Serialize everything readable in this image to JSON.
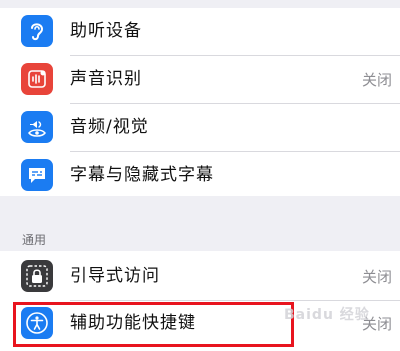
{
  "settings": {
    "rows_top": [
      {
        "label": "助听设备",
        "value": "",
        "icon": "ear-icon",
        "color": "#1b7cf2"
      },
      {
        "label": "声音识别",
        "value": "关闭",
        "icon": "sound-recognition-icon",
        "color": "#e8443a"
      },
      {
        "label": "音频/视觉",
        "value": "",
        "icon": "audio-visual-icon",
        "color": "#1b7cf2"
      },
      {
        "label": "字幕与隐藏式字幕",
        "value": "",
        "icon": "captions-icon",
        "color": "#1b7cf2"
      }
    ],
    "section_header": "通用",
    "rows_general": [
      {
        "label": "引导式访问",
        "value": "关闭",
        "icon": "guided-access-lock-icon",
        "color": "#3a3a3c"
      },
      {
        "label": "辅助功能快捷键",
        "value": "关闭",
        "icon": "accessibility-icon",
        "color": "#1b7cf2"
      }
    ]
  },
  "watermark": {
    "text": "Baidu 经验"
  },
  "highlight_color": "#e8141e"
}
